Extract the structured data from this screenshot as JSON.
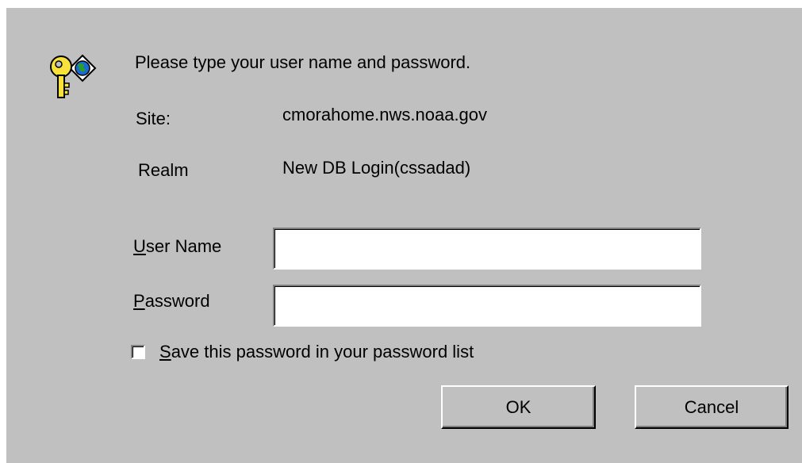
{
  "dialog": {
    "prompt": "Please type your user name and password.",
    "site_label": "Site:",
    "site_value": "cmorahome.nws.noaa.gov",
    "realm_label": "Realm",
    "realm_value": "New DB Login(cssadad)",
    "username": {
      "mnemonic": "U",
      "label_rest": "ser Name",
      "value": ""
    },
    "password": {
      "mnemonic": "P",
      "label_rest": "assword",
      "value": ""
    },
    "save_password": {
      "mnemonic": "S",
      "label_rest": "ave this password in your password list",
      "checked": false
    },
    "ok_label": "OK",
    "cancel_label": "Cancel"
  },
  "icon": "key-globe-icon",
  "colors": {
    "dialog_bg": "#c0c0c0",
    "field_bg": "#ffffff"
  }
}
